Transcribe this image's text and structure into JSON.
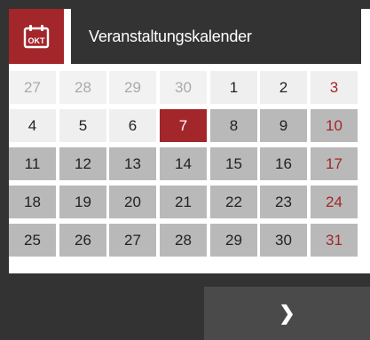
{
  "header": {
    "icon": "calendar-icon",
    "icon_text": "OKT",
    "title": "Veranstaltungskalender"
  },
  "colors": {
    "accent": "#a3262b",
    "dark": "#333333",
    "future_day": "#b9b9b9",
    "light_day": "#efefef"
  },
  "calendar": {
    "weeks": [
      [
        {
          "day": "27",
          "type": "prev"
        },
        {
          "day": "28",
          "type": "prev"
        },
        {
          "day": "29",
          "type": "prev"
        },
        {
          "day": "30",
          "type": "prev"
        },
        {
          "day": "1",
          "type": "cur"
        },
        {
          "day": "2",
          "type": "cur"
        },
        {
          "day": "3",
          "type": "cur-sunday"
        }
      ],
      [
        {
          "day": "4",
          "type": "cur"
        },
        {
          "day": "5",
          "type": "cur"
        },
        {
          "day": "6",
          "type": "cur"
        },
        {
          "day": "7",
          "type": "today"
        },
        {
          "day": "8",
          "type": "future"
        },
        {
          "day": "9",
          "type": "future"
        },
        {
          "day": "10",
          "type": "future-sunday"
        }
      ],
      [
        {
          "day": "11",
          "type": "future"
        },
        {
          "day": "12",
          "type": "future"
        },
        {
          "day": "13",
          "type": "future"
        },
        {
          "day": "14",
          "type": "future"
        },
        {
          "day": "15",
          "type": "future"
        },
        {
          "day": "16",
          "type": "future"
        },
        {
          "day": "17",
          "type": "future-sunday"
        }
      ],
      [
        {
          "day": "18",
          "type": "future"
        },
        {
          "day": "19",
          "type": "future"
        },
        {
          "day": "20",
          "type": "future"
        },
        {
          "day": "21",
          "type": "future"
        },
        {
          "day": "22",
          "type": "future"
        },
        {
          "day": "23",
          "type": "future"
        },
        {
          "day": "24",
          "type": "future-sunday"
        }
      ],
      [
        {
          "day": "25",
          "type": "future"
        },
        {
          "day": "26",
          "type": "future"
        },
        {
          "day": "27",
          "type": "future"
        },
        {
          "day": "28",
          "type": "future"
        },
        {
          "day": "29",
          "type": "future"
        },
        {
          "day": "30",
          "type": "future"
        },
        {
          "day": "31",
          "type": "future-sunday"
        }
      ]
    ]
  },
  "navigation": {
    "next_label": "❯",
    "next_icon": "chevron-right-icon"
  }
}
